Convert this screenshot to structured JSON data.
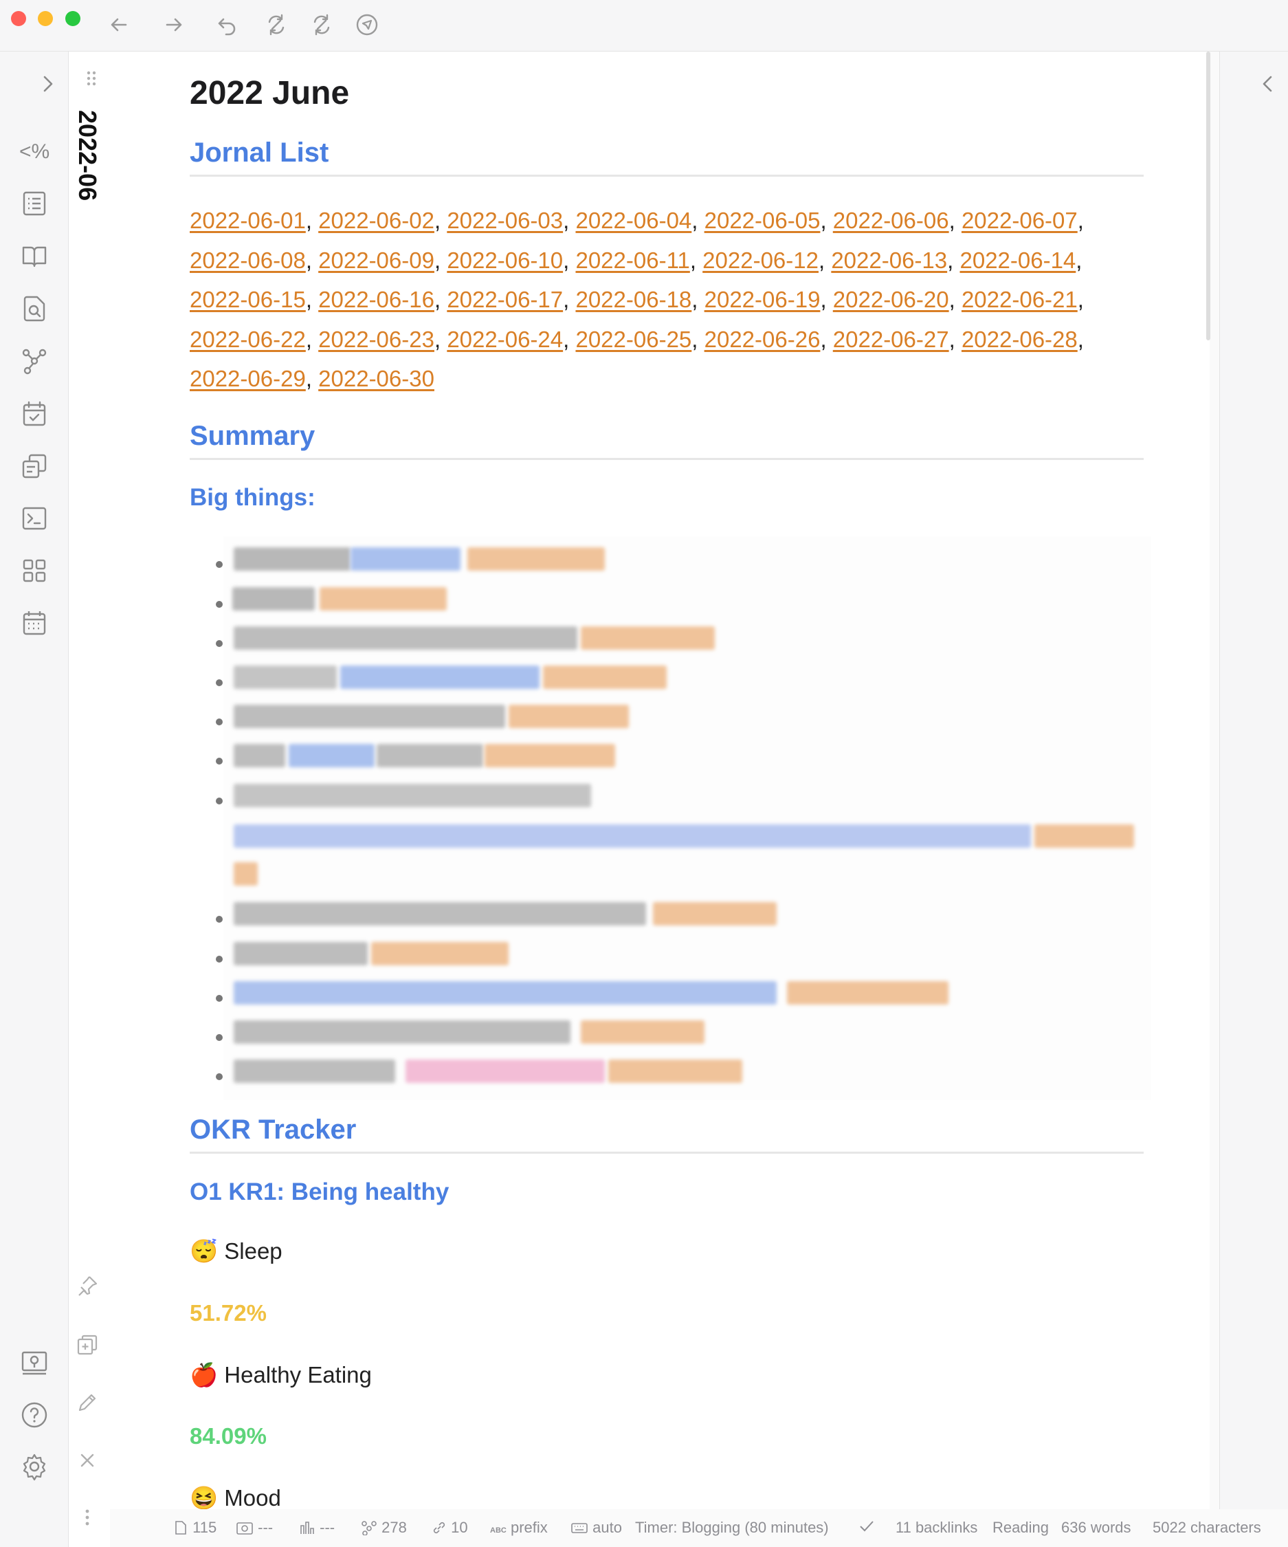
{
  "window": {
    "traffic_lights": [
      "close",
      "minimize",
      "zoom"
    ],
    "toolbar_icons": [
      "back-arrow-icon",
      "forward-arrow-icon",
      "undo-icon",
      "sync-icon",
      "sync-alt-icon",
      "navigate-icon"
    ]
  },
  "ribbon": {
    "toggle_icon": "chevron-right-icon",
    "icons": [
      "templater-icon",
      "outline-icon",
      "book-icon",
      "search-file-icon",
      "graph-icon",
      "calendar-check-icon",
      "copy-icon",
      "terminal-icon",
      "apps-icon",
      "calendar-icon"
    ],
    "bottom_icons": [
      "vault-icon",
      "help-icon",
      "settings-icon"
    ]
  },
  "tab": {
    "vertical_title": "2022-06",
    "icons": [
      "drag-handle-icon",
      "pin-icon",
      "add-pane-icon",
      "edit-icon",
      "close-icon",
      "more-icon"
    ]
  },
  "right_panel": {
    "toggle_icon": "chevron-left-icon"
  },
  "note": {
    "title": "2022 June",
    "journal_heading": "Jornal List",
    "journal_dates": [
      "2022-06-01",
      "2022-06-02",
      "2022-06-03",
      "2022-06-04",
      "2022-06-05",
      "2022-06-06",
      "2022-06-07",
      "2022-06-08",
      "2022-06-09",
      "2022-06-10",
      "2022-06-11",
      "2022-06-12",
      "2022-06-13",
      "2022-06-14",
      "2022-06-15",
      "2022-06-16",
      "2022-06-17",
      "2022-06-18",
      "2022-06-19",
      "2022-06-20",
      "2022-06-21",
      "2022-06-22",
      "2022-06-23",
      "2022-06-24",
      "2022-06-25",
      "2022-06-26",
      "2022-06-27",
      "2022-06-28",
      "2022-06-29",
      "2022-06-30"
    ],
    "summary_heading": "Summary",
    "big_things_heading": "Big things:",
    "okr_heading": "OKR Tracker",
    "okr_sub": "O1 KR1: Being healthy",
    "sleep_label": "😴 Sleep",
    "sleep_pct": "51.72%",
    "eating_label": "🍎 Healthy Eating",
    "eating_pct": "84.09%",
    "mood_label": "😆 Mood",
    "colors": {
      "heading": "#4a7fe0",
      "link": "#d97f26",
      "sleep_pct": "#f0c040",
      "eating_pct": "#5ed47a"
    }
  },
  "status": {
    "edits": "115",
    "capture": "---",
    "chart": "---",
    "graph": "278",
    "links": "10",
    "prefix": "prefix",
    "keyboard": "auto",
    "timer": "Timer: Blogging (80 minutes)",
    "backlinks": "11 backlinks",
    "mode": "Reading",
    "words": "636 words",
    "characters": "5022 characters"
  }
}
